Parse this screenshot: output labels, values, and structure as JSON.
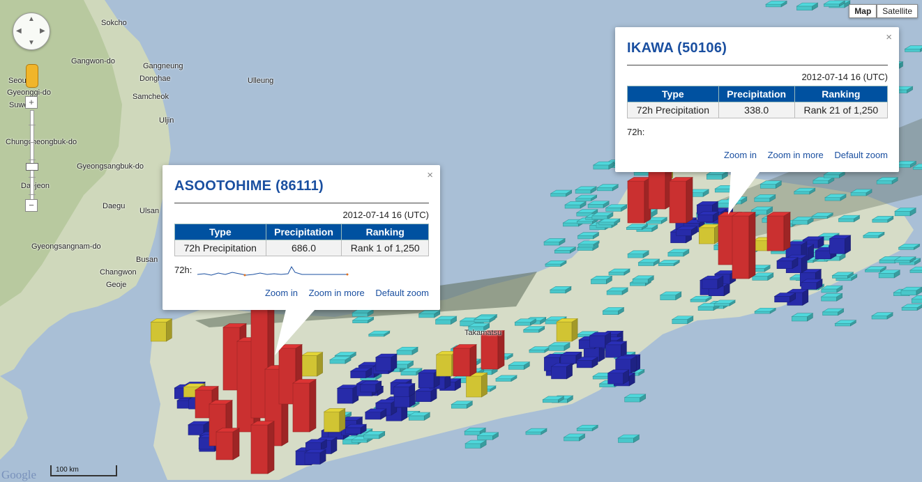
{
  "map_type": {
    "map_label": "Map",
    "satellite_label": "Satellite",
    "active": "Map"
  },
  "places": [
    {
      "name": "Sokcho"
    },
    {
      "name": "Gangwon-do"
    },
    {
      "name": "Gangneung"
    },
    {
      "name": "Donghae"
    },
    {
      "name": "Samcheok"
    },
    {
      "name": "Ulleung"
    },
    {
      "name": "Uljin"
    },
    {
      "name": "Gyeonggi-do"
    },
    {
      "name": "Seoul"
    },
    {
      "name": "Suwon"
    },
    {
      "name": "Chungcheongbuk-do"
    },
    {
      "name": "Gyeongsangbuk-do"
    },
    {
      "name": "Daejeon"
    },
    {
      "name": "Daegu"
    },
    {
      "name": "Ulsan"
    },
    {
      "name": "Gyeongsangnam-do"
    },
    {
      "name": "Busan"
    },
    {
      "name": "Changwon"
    },
    {
      "name": "Geoje"
    },
    {
      "name": "Takamatsu"
    }
  ],
  "scale_label": "100 km",
  "logo_text": "Google",
  "infowindows": [
    {
      "title": "ASOOTOHIME (86111)",
      "date": "2012-07-14 16 (UTC)",
      "headers": [
        "Type",
        "Precipitation",
        "Ranking"
      ],
      "row": [
        "72h Precipitation",
        "686.0",
        "Rank 1 of 1,250"
      ],
      "sparkline_label": "72h:",
      "links": [
        "Zoom in",
        "Zoom in more",
        "Default zoom"
      ],
      "close": "×"
    },
    {
      "title": "IKAWA (50106)",
      "date": "2012-07-14 16 (UTC)",
      "headers": [
        "Type",
        "Precipitation",
        "Ranking"
      ],
      "row": [
        "72h Precipitation",
        "338.0",
        "Rank 21 of 1,250"
      ],
      "sparkline_label": "72h:",
      "links": [
        "Zoom in",
        "Zoom in more",
        "Default zoom"
      ],
      "close": "×"
    }
  ],
  "colors": {
    "water": "#a9bfd6",
    "land": "#dde3d0",
    "cyan": "#4fd8dc",
    "blue": "#2a2fb8",
    "yellow": "#e3d537",
    "red": "#dc3434",
    "title_blue": "#1a4fa0",
    "header_blue": "#0051a0"
  }
}
